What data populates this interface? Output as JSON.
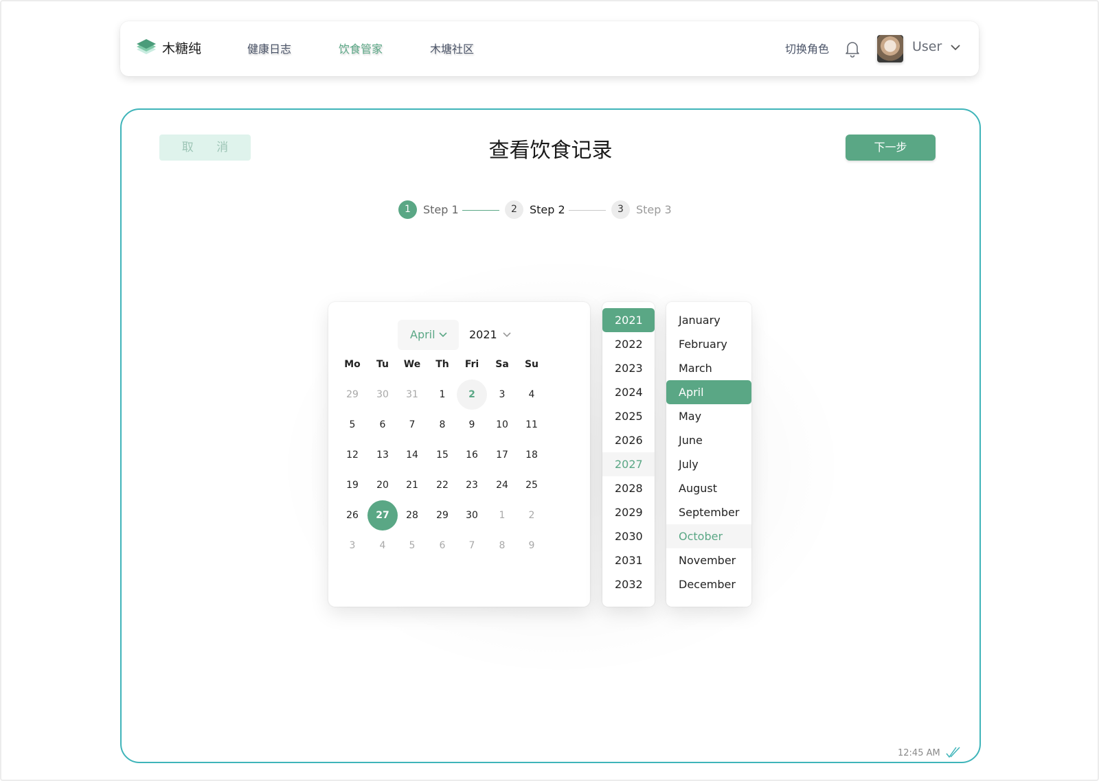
{
  "nav": {
    "logo_text": "木糖纯",
    "links": [
      "健康日志",
      "饮食管家",
      "木塘社区"
    ],
    "active_link": "饮食管家",
    "role_switch": "切换角色",
    "user_name": "User",
    "icons": [
      "logo-icon",
      "bell-icon",
      "avatar",
      "chevron-down-icon"
    ]
  },
  "page": {
    "cancel_label": "取 消",
    "title": "查看饮食记录",
    "next_label": "下一步"
  },
  "steps": [
    {
      "number": "1",
      "label": "Step 1",
      "state": "done"
    },
    {
      "number": "2",
      "label": "Step 2",
      "state": "current"
    },
    {
      "number": "3",
      "label": "Step 3",
      "state": "pending"
    }
  ],
  "calendar": {
    "month_label": "April",
    "year_label": "2021",
    "weekdays": [
      "Mo",
      "Tu",
      "We",
      "Th",
      "Fri",
      "Sa",
      "Su"
    ],
    "weeks": [
      [
        "29",
        "30",
        "31",
        "1",
        "2",
        "3",
        "4"
      ],
      [
        "5",
        "6",
        "7",
        "8",
        "9",
        "10",
        "11"
      ],
      [
        "12",
        "13",
        "14",
        "15",
        "16",
        "17",
        "18"
      ],
      [
        "19",
        "20",
        "21",
        "22",
        "23",
        "24",
        "25"
      ],
      [
        "26",
        "27",
        "28",
        "29",
        "30",
        "1",
        "2"
      ],
      [
        "3",
        "4",
        "5",
        "6",
        "7",
        "8",
        "9"
      ]
    ],
    "today": "2",
    "selected": "27"
  },
  "years": [
    "2021",
    "2022",
    "2023",
    "2024",
    "2025",
    "2026",
    "2027",
    "2028",
    "2029",
    "2030",
    "2031",
    "2032"
  ],
  "selected_year": "2021",
  "hovered_year": "2027",
  "months": [
    "January",
    "February",
    "March",
    "April",
    "May",
    "June",
    "July",
    "August",
    "September",
    "October",
    "November",
    "December"
  ],
  "selected_month": "April",
  "hovered_month": "October",
  "footer": {
    "timestamp": "12:45 AM"
  },
  "colors": {
    "accent": "#5aa785",
    "card_border": "#3eb4b9",
    "cancel_bg": "#dff3ec"
  }
}
